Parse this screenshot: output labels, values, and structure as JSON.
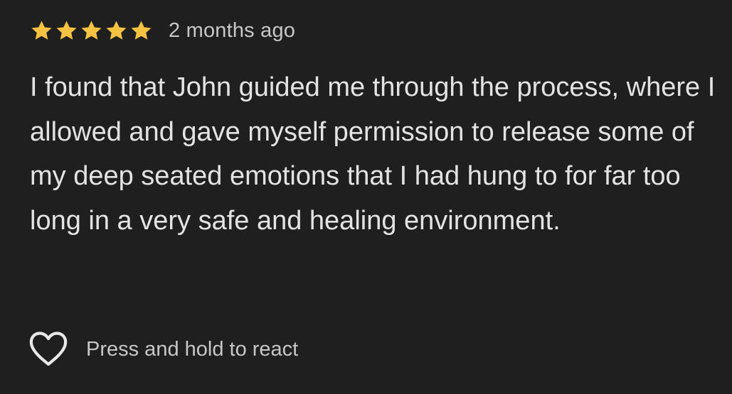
{
  "review": {
    "rating": 5,
    "rating_max": 5,
    "date": "2 months ago",
    "text": "I found that John guided me through the process, where I allowed and gave myself permission to release some of my deep seated emotions that I had hung to for far too long in a very safe and healing environment."
  },
  "reaction": {
    "icon": "heart-outline-icon",
    "hint": "Press and hold to react"
  },
  "colors": {
    "background": "#1f1f1f",
    "star": "#f5c242",
    "text": "#e3e3e3",
    "secondary_text": "#c7c7c7"
  }
}
